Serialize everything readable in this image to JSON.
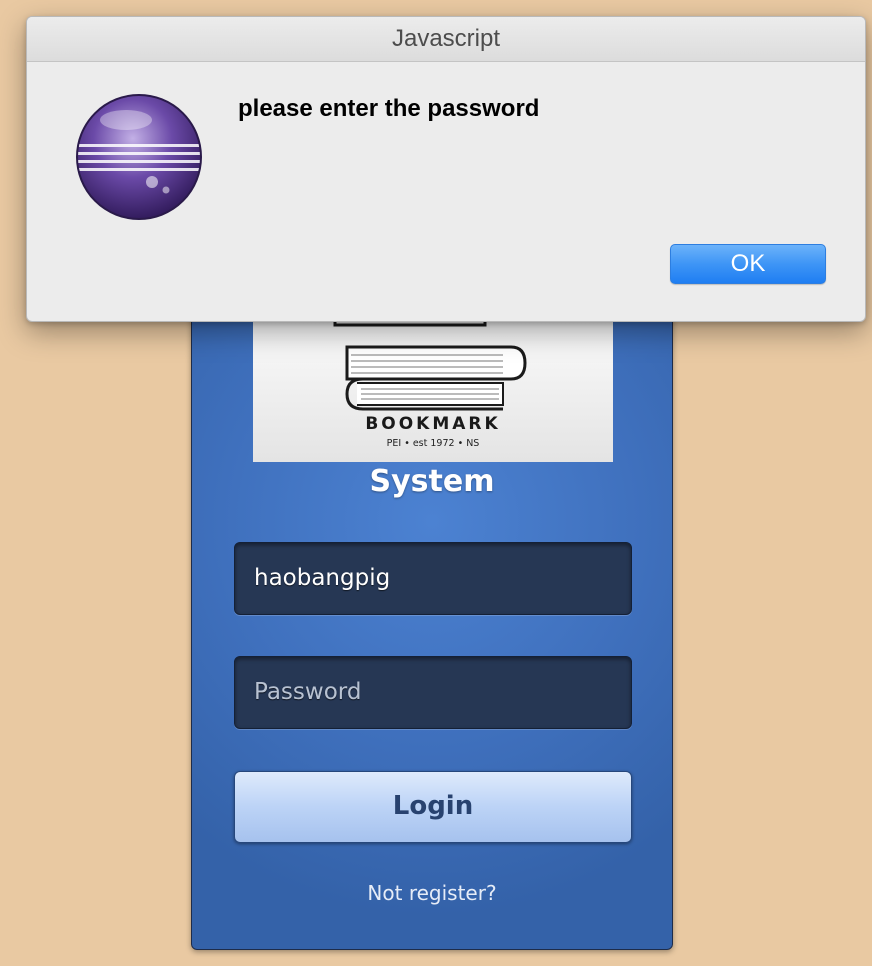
{
  "alert": {
    "title": "Javascript",
    "message": "please enter the password",
    "ok_label": "OK",
    "icon": "eclipse-sphere-icon"
  },
  "login": {
    "logo": {
      "word": "BOOKMARK",
      "tagline": "PEI • est 1972 • NS",
      "icon": "book-stack-icon"
    },
    "title": "System",
    "username_value": "haobangpig",
    "password_placeholder": "Password",
    "login_label": "Login",
    "register_label": "Not register?"
  },
  "colors": {
    "background": "#e9c9a2",
    "panel": "#3f70bd",
    "field": "#263754",
    "ok_button": "#3e95f6"
  }
}
